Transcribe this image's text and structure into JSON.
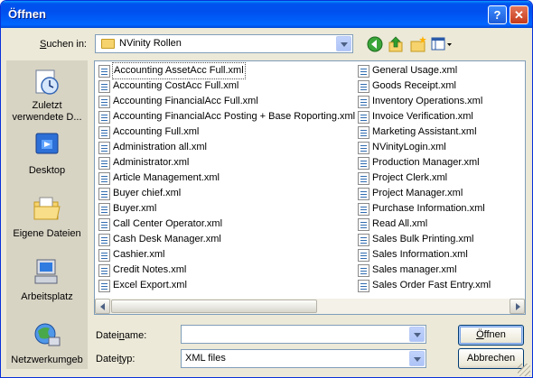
{
  "window": {
    "title": "Öffnen"
  },
  "titlebar_buttons": {
    "help": "?",
    "close": "✕"
  },
  "look_in": {
    "label_pre": "",
    "label_u": "S",
    "label_post": "uchen in:",
    "value": "NVinity Rollen"
  },
  "toolbar": {
    "icons": [
      "back-icon",
      "up-folder-icon",
      "new-folder-icon",
      "view-menu-icon"
    ]
  },
  "places": [
    {
      "name": "recent",
      "label": "Zuletzt verwendete D...",
      "icon": "recent-documents-icon"
    },
    {
      "name": "desktop",
      "label": "Desktop",
      "icon": "desktop-icon"
    },
    {
      "name": "my-documents",
      "label": "Eigene Dateien",
      "icon": "my-documents-icon"
    },
    {
      "name": "my-computer",
      "label": "Arbeitsplatz",
      "icon": "my-computer-icon"
    },
    {
      "name": "network",
      "label": "Netzwerkumgeb",
      "icon": "network-places-icon"
    }
  ],
  "files_col1": [
    "Accounting AssetAcc Full.xml",
    "Accounting CostAcc Full.xml",
    "Accounting FinancialAcc Full.xml",
    "Accounting FinancialAcc Posting + Base Roporting.xml",
    "Accounting Full.xml",
    "Administration all.xml",
    "Administrator.xml",
    "Article Management.xml",
    "Buyer chief.xml",
    "Buyer.xml",
    "Call Center Operator.xml",
    "Cash Desk Manager.xml",
    "Cashier.xml",
    "Credit Notes.xml",
    "Excel Export.xml"
  ],
  "files_col2": [
    "General Usage.xml",
    "Goods Receipt.xml",
    "Inventory Operations.xml",
    "Invoice Verification.xml",
    "Marketing Assistant.xml",
    "NVinityLogin.xml",
    "Production Manager.xml",
    "Project Clerk.xml",
    "Project Manager.xml",
    "Purchase Information.xml",
    "Read All.xml",
    "Sales Bulk Printing.xml",
    "Sales Information.xml",
    "Sales manager.xml",
    "Sales Order Fast Entry.xml"
  ],
  "filename": {
    "label_pre": "Datei",
    "label_u": "n",
    "label_post": "ame:",
    "value": ""
  },
  "filetype": {
    "label_pre": "Datei",
    "label_u": "t",
    "label_post": "yp:",
    "value": "XML files"
  },
  "buttons": {
    "open_u": "Ö",
    "open_post": "ffnen",
    "cancel": "Abbrechen"
  },
  "colors": {
    "titlebar": "#0050ee",
    "dialog_bg": "#ece9d8",
    "places_bg": "#d8d4c4"
  }
}
